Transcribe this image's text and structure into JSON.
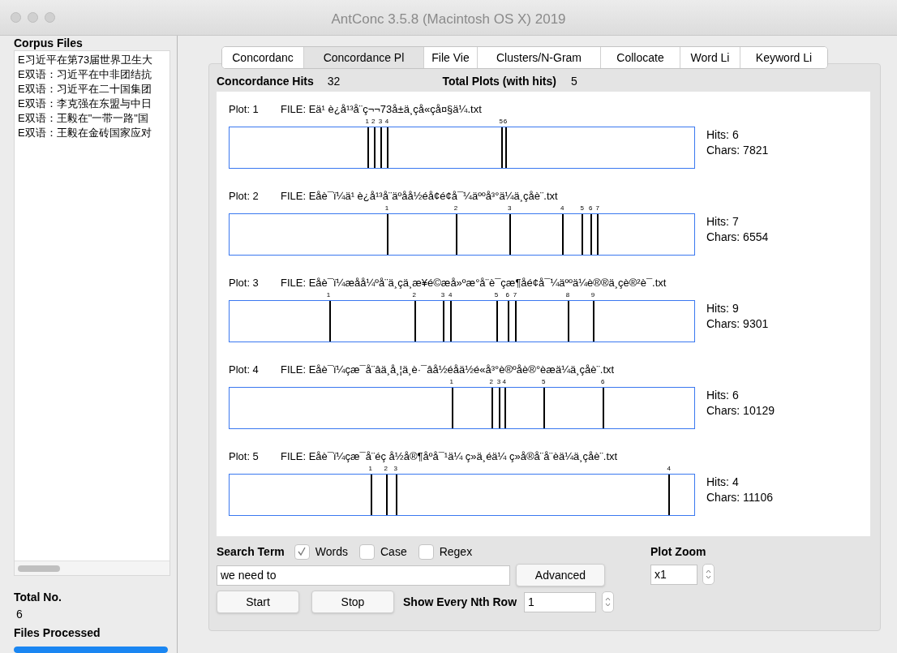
{
  "window": {
    "title": "AntConc 3.5.8 (Macintosh OS X) 2019"
  },
  "corpus_files": {
    "title": "Corpus Files",
    "items": [
      {
        "label": "E习近平在第73届世界卫生大"
      },
      {
        "label": "E双语：习近平在中非团结抗"
      },
      {
        "label": "E双语：习近平在二十国集团"
      },
      {
        "label": "E双语：李克强在东盟与中日"
      },
      {
        "label": "E双语：王毅在\"一带一路\"国"
      },
      {
        "label": "E双语：王毅在金砖国家应对"
      }
    ]
  },
  "total": {
    "label": "Total No.",
    "value": "6"
  },
  "files_processed": {
    "label": "Files Processed",
    "level": 1
  },
  "tabs": [
    {
      "label": "Concordanc",
      "selected": false
    },
    {
      "label": "Concordance Pl",
      "selected": true
    },
    {
      "label": "File Vie",
      "selected": false
    },
    {
      "label": "Clusters/N-Gram",
      "selected": false
    },
    {
      "label": "Collocate",
      "selected": false
    },
    {
      "label": "Word Li",
      "selected": false
    },
    {
      "label": "Keyword Li",
      "selected": false
    }
  ],
  "summary": {
    "hits_label": "Concordance Hits",
    "hits": "32",
    "plots_label": "Total Plots (with hits)",
    "plots": "5"
  },
  "plots": [
    {
      "plot": "Plot: 1",
      "file": "FILE: Eä¹ è¿å¹³å¨ç¬¬73å±ä¸çå«çå¤§ä¼.txt",
      "hits": "Hits: 6",
      "chars": "Chars: 7821",
      "marks": [
        "1",
        "2",
        "3",
        "4",
        "5",
        "6"
      ]
    },
    {
      "plot": "Plot: 2",
      "file": "FILE: Eåè¯ï¼ä¹ è¿å¹³å¨äºåå½éå¢é¢å¯¼äººå³°ä¼ä¸çåè¨.txt",
      "hits": "Hits: 7",
      "chars": "Chars: 6554",
      "marks": [
        "1",
        "2",
        "3",
        "4",
        "5",
        "6",
        "7"
      ]
    },
    {
      "plot": "Plot: 3",
      "file": "FILE: Eåè¯ï¼æåå¼ºå¨ä¸çä¸æ¥é©æå»ºæ°å¨è¯çæ¶åé¢å¯¼äººä¼è®®ä¸çè®²è¯.txt",
      "hits": "Hits: 9",
      "chars": "Chars: 9301",
      "marks": [
        "1",
        "2",
        "3",
        "4",
        "5",
        "6",
        "7",
        "8",
        "9"
      ]
    },
    {
      "plot": "Plot: 4",
      "file": "FILE: Eåè¯ï¼çæ¯å¨âä¸å¸¦ä¸è·¯âå½éåä½é«å³°è®ºåè®°èæä¼ä¸çåè¨.txt",
      "hits": "Hits: 6",
      "chars": "Chars: 10129",
      "marks": [
        "1",
        "2",
        "3",
        "4",
        "5",
        "6"
      ]
    },
    {
      "plot": "Plot: 5",
      "file": "FILE: Eåè¯ï¼çæ¯å¨éç å½å®¶åºå¯¹ä¼ ç»ä¸éä¼ ç»å®å¨å¨èä¼ä¸çåè¨.txt",
      "hits": "Hits: 4",
      "chars": "Chars: 11106",
      "marks": [
        "1",
        "2",
        "3",
        "4"
      ]
    }
  ],
  "search": {
    "label": "Search Term",
    "options": [
      {
        "label": "Words",
        "checked": true
      },
      {
        "label": "Case",
        "checked": false
      },
      {
        "label": "Regex",
        "checked": false
      }
    ],
    "value": "we need to",
    "advanced": "Advanced",
    "start": "Start",
    "stop": "Stop",
    "nth_label": "Show Every Nth Row",
    "nth": "1"
  },
  "zoom": {
    "label": "Plot Zoom",
    "value": "x1"
  }
}
